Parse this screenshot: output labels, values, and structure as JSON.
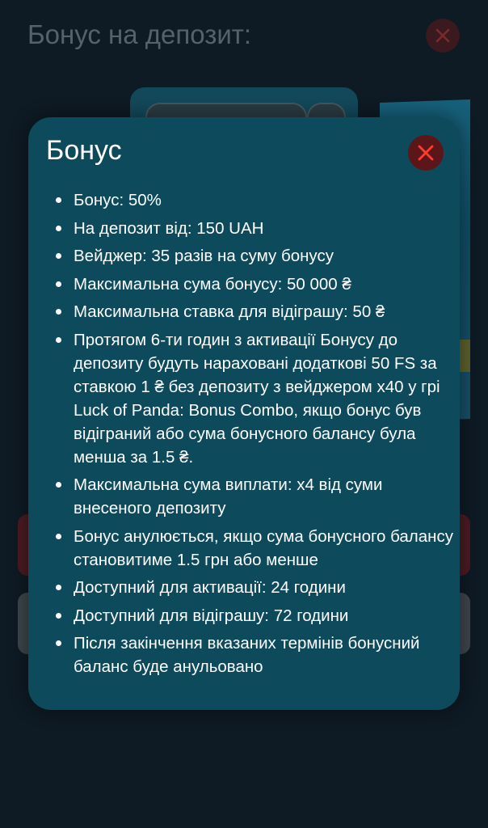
{
  "background": {
    "title": "Бонус на депозит:"
  },
  "modal": {
    "title": "Бонус",
    "close_icon": "close-icon",
    "items": [
      "Бонус: 50%",
      "На депозит від: 150 UAH",
      "Вейджер: 35 разів на суму бонусу",
      "Максимальна сума бонусу: 50 000 ₴",
      "Максимальна ставка для відіграшу: 50 ₴",
      "Протягом 6-ти годин з активації Бонусу до депозиту будуть нараховані додаткові 50 FS за ставкою 1 ₴ без депозиту з вейджером x40 у грі Luck of Panda: Bonus Combo, якщо бонус був відіграний або сума бонусного балансу була менша за 1.5 ₴.",
      "Максимальна сума виплати: x4 від суми внесеного депозиту",
      "Бонус анулюється, якщо сума бонусного балансу становитиме 1.5 грн або менше",
      "Доступний для активації: 24 години",
      "Доступний для відіграшу: 72 години",
      "Після закінчення вказаних термінів бонусний баланс буде анульовано"
    ]
  },
  "colors": {
    "modal_bg": "#0d4a5c",
    "page_bg": "#0e1a24",
    "close_bg": "#5c1619",
    "close_x": "#ff3b2f"
  }
}
